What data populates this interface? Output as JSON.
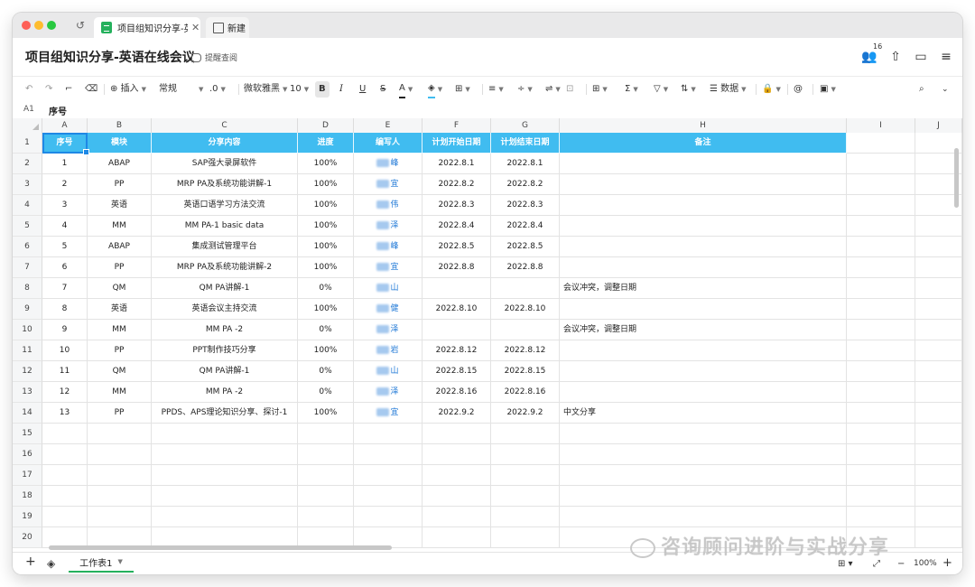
{
  "tabs": {
    "active_title": "项目组知识分享-英语",
    "new_label": "新建"
  },
  "header": {
    "title": "项目组知识分享-英语在线会议",
    "remind_label": "提醒查阅",
    "collab_count": "16"
  },
  "toolbar": {
    "insert_label": "插入",
    "format_label": "常规",
    "decimal_label": ".0",
    "font_label": "微软雅黑",
    "size_label": "10",
    "bold_label": "B",
    "italic_label": "I",
    "underline_label": "U",
    "strike_label": "S",
    "font_color_label": "A",
    "sum_label": "Σ",
    "data_label": "数据",
    "at_label": "@"
  },
  "formula": {
    "cell_ref": "A1",
    "value": "序号"
  },
  "columns": [
    "A",
    "B",
    "C",
    "D",
    "E",
    "F",
    "G",
    "H",
    "I",
    "J"
  ],
  "table": {
    "headers": [
      "序号",
      "模块",
      "分享内容",
      "进度",
      "编写人",
      "计划开始日期",
      "计划结束日期",
      "备注"
    ],
    "rows": [
      {
        "n": "1",
        "mod": "ABAP",
        "content": "SAP强大录屏软件",
        "prog": "100%",
        "author": "峰",
        "start": "2022.8.1",
        "end": "2022.8.1",
        "note": ""
      },
      {
        "n": "2",
        "mod": "PP",
        "content": "MRP PA及系统功能讲解-1",
        "prog": "100%",
        "author": "宜",
        "start": "2022.8.2",
        "end": "2022.8.2",
        "note": ""
      },
      {
        "n": "3",
        "mod": "英语",
        "content": "英语口语学习方法交流",
        "prog": "100%",
        "author": "伟",
        "start": "2022.8.3",
        "end": "2022.8.3",
        "note": ""
      },
      {
        "n": "4",
        "mod": "MM",
        "content": "MM PA-1 basic data",
        "prog": "100%",
        "author": "泽",
        "start": "2022.8.4",
        "end": "2022.8.4",
        "note": ""
      },
      {
        "n": "5",
        "mod": "ABAP",
        "content": "集成测试管理平台",
        "prog": "100%",
        "author": "峰",
        "start": "2022.8.5",
        "end": "2022.8.5",
        "note": ""
      },
      {
        "n": "6",
        "mod": "PP",
        "content": "MRP PA及系统功能讲解-2",
        "prog": "100%",
        "author": "宜",
        "start": "2022.8.8",
        "end": "2022.8.8",
        "note": ""
      },
      {
        "n": "7",
        "mod": "QM",
        "content": "QM PA讲解-1",
        "prog": "0%",
        "author": "山",
        "start": "",
        "end": "",
        "note": "会议冲突，调整日期"
      },
      {
        "n": "8",
        "mod": "英语",
        "content": "英语会议主持交流",
        "prog": "100%",
        "author": "健",
        "start": "2022.8.10",
        "end": "2022.8.10",
        "note": ""
      },
      {
        "n": "9",
        "mod": "MM",
        "content": "MM PA -2",
        "prog": "0%",
        "author": "泽",
        "start": "",
        "end": "",
        "note": "会议冲突，调整日期"
      },
      {
        "n": "10",
        "mod": "PP",
        "content": "PPT制作技巧分享",
        "prog": "100%",
        "author": "岩",
        "start": "2022.8.12",
        "end": "2022.8.12",
        "note": ""
      },
      {
        "n": "11",
        "mod": "QM",
        "content": "QM PA讲解-1",
        "prog": "0%",
        "author": "山",
        "start": "2022.8.15",
        "end": "2022.8.15",
        "note": ""
      },
      {
        "n": "12",
        "mod": "MM",
        "content": "MM PA -2",
        "prog": "0%",
        "author": "泽",
        "start": "2022.8.16",
        "end": "2022.8.16",
        "note": ""
      },
      {
        "n": "13",
        "mod": "PP",
        "content": "PPDS、APS理论知识分享、探讨-1",
        "prog": "100%",
        "author": "宜",
        "start": "2022.9.2",
        "end": "2022.9.2",
        "note": "中文分享"
      }
    ],
    "row_numbers": [
      "1",
      "2",
      "3",
      "4",
      "5",
      "6",
      "7",
      "8",
      "9",
      "10",
      "11",
      "12",
      "13",
      "14",
      "15",
      "16",
      "17",
      "18",
      "19",
      "20"
    ]
  },
  "bottom": {
    "sheet_name": "工作表1",
    "zoom": "100%"
  },
  "watermark": "咨询顾问进阶与实战分享"
}
